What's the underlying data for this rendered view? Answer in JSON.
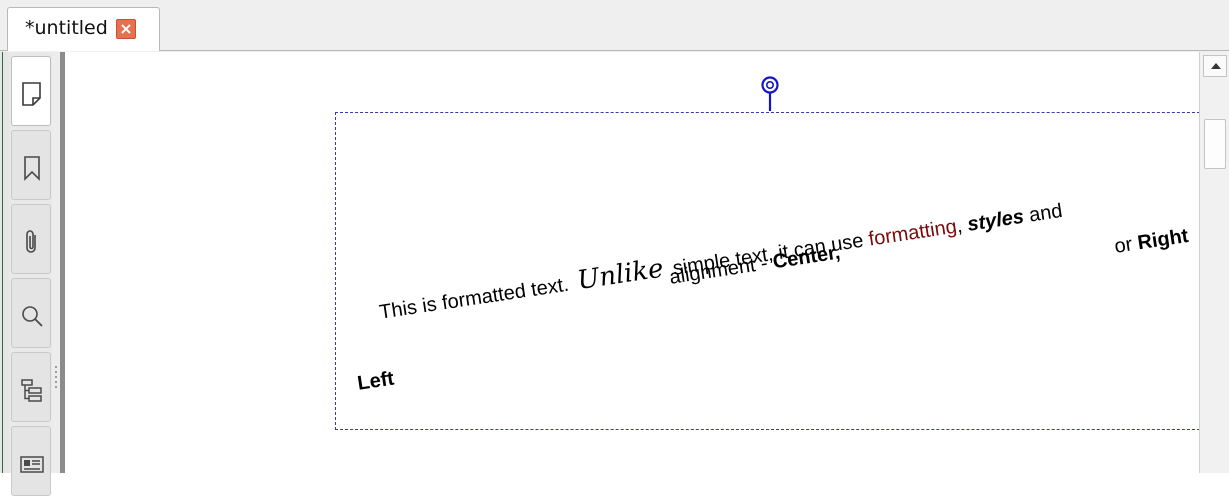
{
  "tab": {
    "title": "*untitled"
  },
  "side_panel": {
    "buttons": [
      {
        "name": "page-icon",
        "active": true
      },
      {
        "name": "bookmark-icon",
        "active": false
      },
      {
        "name": "attachment-icon",
        "active": false
      },
      {
        "name": "search-icon",
        "active": false
      },
      {
        "name": "structure-tree-icon",
        "active": false
      },
      {
        "name": "contact-card-icon",
        "active": false
      }
    ]
  },
  "text_block": {
    "line1": {
      "plain1": "This is formatted text.",
      "script_word": "Unlike",
      "plain2": "simple text, it can use",
      "colored_word": "formatting",
      "comma": ",",
      "styled_word": "styles",
      "plain3": "and"
    },
    "line2": {
      "plain": "alignment -",
      "center_word": "Center,",
      "or_word": "or",
      "right_word": "Right"
    },
    "line3": {
      "left_word": "Left"
    }
  },
  "colors": {
    "accent_close": "#e8704f",
    "frame_border": "#3a3aa8",
    "rotate_handle": "#1414c8",
    "formatting_word": "#7b0a0a"
  }
}
